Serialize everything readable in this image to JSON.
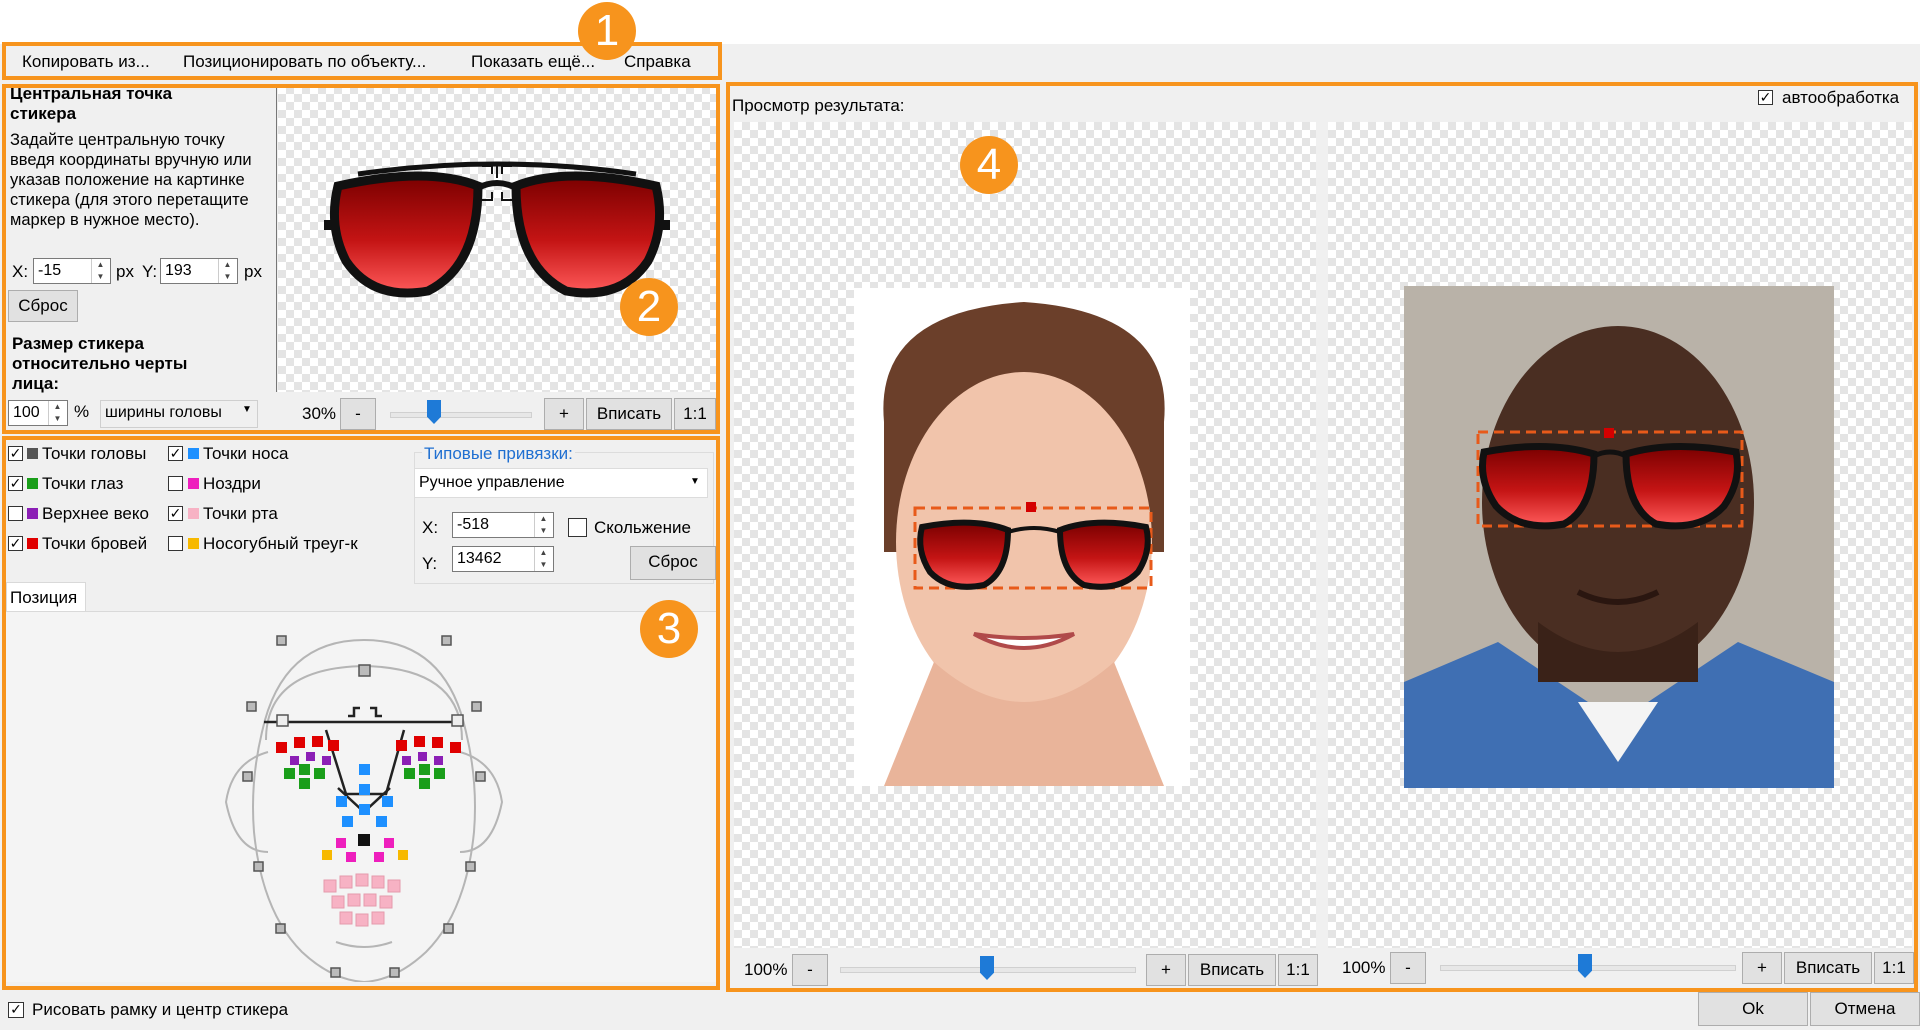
{
  "menu": {
    "items": [
      "Копировать из...",
      "Позиционировать по объекту...",
      "Показать ещё...",
      "Справка"
    ]
  },
  "badges": [
    "1",
    "2",
    "3",
    "4"
  ],
  "sticker_center": {
    "title": "Центральная точка стикера",
    "description": "Задайте центральную точку введя координаты вручную или указав положение на картинке стикера (для этого перетащите маркер в нужное место).",
    "x_label": "X:",
    "x_value": "-15",
    "y_label": "Y:",
    "y_value": "193",
    "unit": "px",
    "reset_label": "Сброс",
    "size_title": "Размер стикера относительно черты лица:",
    "size_value": "100",
    "size_unit": "%",
    "size_mode": "ширины головы",
    "zoom": "30%",
    "minus": "-",
    "plus": "+",
    "fit_label": "Вписать",
    "one_to_one": "1:1"
  },
  "points": {
    "checkboxes": [
      {
        "label": "Точки головы",
        "checked": true,
        "color": "#555555"
      },
      {
        "label": "Точки глаз",
        "checked": true,
        "color": "#1a9e1a"
      },
      {
        "label": "Верхнее веко",
        "checked": false,
        "color": "#8b1fb5"
      },
      {
        "label": "Точки бровей",
        "checked": true,
        "color": "#e00000"
      },
      {
        "label": "Точки носа",
        "checked": true,
        "color": "#1e90ff"
      },
      {
        "label": "Ноздри",
        "checked": false,
        "color": "#ee1fbd"
      },
      {
        "label": "Точки рта",
        "checked": true,
        "color": "#f7b2c4"
      },
      {
        "label": "Носогубный треуг-к",
        "checked": false,
        "color": "#f7b900"
      }
    ],
    "binding_title": "Типовые привязки:",
    "binding_value": "Ручное управление",
    "x_label": "X:",
    "x_value": "-518",
    "y_label": "Y:",
    "y_value": "13462",
    "slide_label": "Скольжение",
    "slide_checked": false,
    "reset_label": "Сброс",
    "tab_label": "Позиция"
  },
  "preview": {
    "title": "Просмотр результата:",
    "auto_label": "автообработка",
    "auto_checked": true,
    "left": {
      "zoom": "100%",
      "minus": "-",
      "plus": "+",
      "fit_label": "Вписать",
      "one_to_one": "1:1"
    },
    "right": {
      "zoom": "100%",
      "minus": "-",
      "plus": "+",
      "fit_label": "Вписать",
      "one_to_one": "1:1"
    }
  },
  "footer": {
    "draw_frame_label": "Рисовать рамку и центр стикера",
    "draw_frame_checked": true,
    "ok_label": "Ok",
    "cancel_label": "Отмена"
  },
  "colors": {
    "accent": "#f7941d",
    "slider": "#1e7ad7",
    "link": "#1f6fd1"
  }
}
